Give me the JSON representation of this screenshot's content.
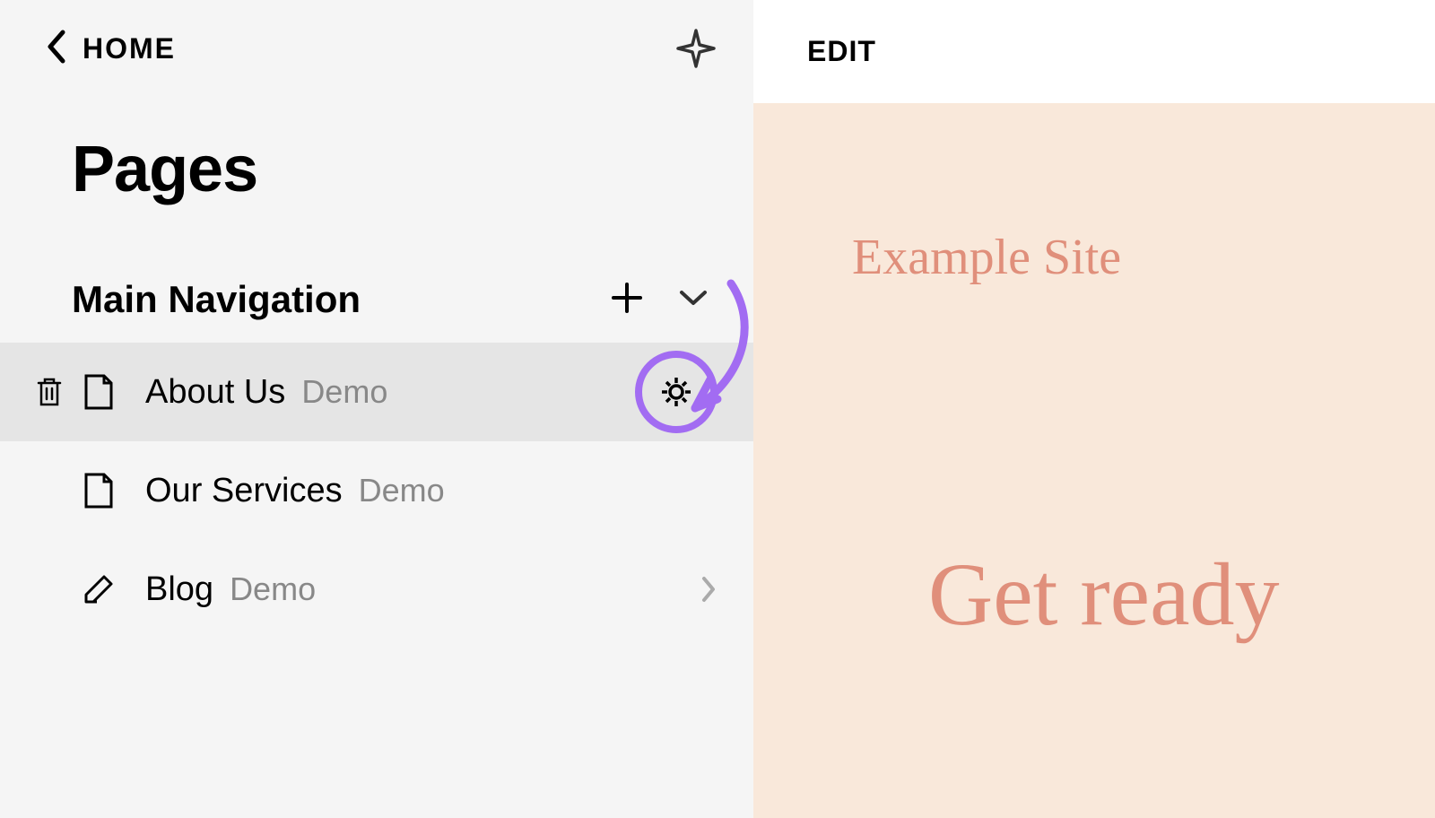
{
  "sidebar": {
    "back_label": "HOME",
    "title": "Pages",
    "section_title": "Main Navigation",
    "items": [
      {
        "label": "About Us",
        "tag": "Demo",
        "icon": "page",
        "active": true,
        "has_gear": true,
        "has_trash": true
      },
      {
        "label": "Our Services",
        "tag": "Demo",
        "icon": "page",
        "active": false
      },
      {
        "label": "Blog",
        "tag": "Demo",
        "icon": "blog",
        "active": false,
        "has_chevron": true
      }
    ]
  },
  "preview": {
    "edit_label": "EDIT",
    "site_title": "Example Site",
    "hero_text": "Get ready"
  },
  "annotation": {
    "highlight_color": "#a26cf2"
  }
}
